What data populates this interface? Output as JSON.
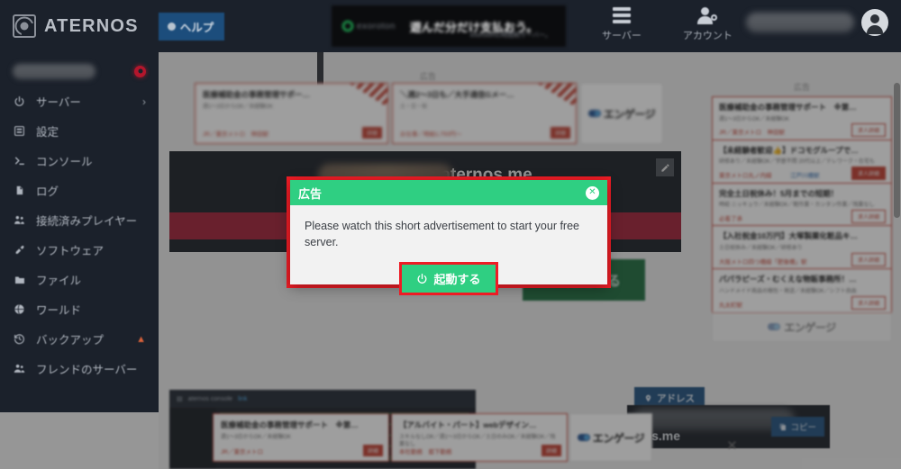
{
  "header": {
    "brand": "ATERNOS",
    "help_label": "ヘルプ",
    "ad": {
      "brand": "exoroton",
      "brand_sub": "by aternos",
      "headline": "遊んだ分だけ支払おう。",
      "subline": "exorotonの時間制サーバー。"
    },
    "nav": [
      {
        "label": "サーバー",
        "icon": "server-stack-icon"
      },
      {
        "label": "アカウント",
        "icon": "account-person-icon"
      }
    ],
    "user": {
      "name_redacted": "",
      "status_redacted": ""
    }
  },
  "sidebar": {
    "server_name_redacted": "",
    "status": "offline",
    "items": [
      {
        "label": "サーバー",
        "icon": "power-icon",
        "chevron": "›",
        "warn": ""
      },
      {
        "label": "設定",
        "icon": "sliders-icon",
        "chevron": "",
        "warn": ""
      },
      {
        "label": "コンソール",
        "icon": "terminal-icon",
        "chevron": "",
        "warn": ""
      },
      {
        "label": "ログ",
        "icon": "document-icon",
        "chevron": "",
        "warn": ""
      },
      {
        "label": "接続済みプレイヤー",
        "icon": "players-icon",
        "chevron": "",
        "warn": ""
      },
      {
        "label": "ソフトウェア",
        "icon": "plug-icon",
        "chevron": "",
        "warn": ""
      },
      {
        "label": "ファイル",
        "icon": "folder-icon",
        "chevron": "",
        "warn": ""
      },
      {
        "label": "ワールド",
        "icon": "globe-icon",
        "chevron": "",
        "warn": ""
      },
      {
        "label": "バックアップ",
        "icon": "history-icon",
        "chevron": "",
        "warn": "▲"
      },
      {
        "label": "フレンドのサーバー",
        "icon": "friends-icon",
        "chevron": "",
        "warn": ""
      }
    ]
  },
  "main": {
    "ad_label": "広告",
    "server_address_suffix": "aternos.me",
    "server_name_redacted": "",
    "edit_icon": "pencil-icon",
    "start_button_label": "起動する",
    "address_tab_label": "アドレス",
    "address_value_suffix": "nos.me",
    "copy_button_label": "コピー",
    "close_label": "×",
    "engage_brand": "エンゲージ"
  },
  "ads": {
    "top": [
      {
        "title": "医療補助金の事務管理サポー…",
        "desc": "週1〜3日からOK／未経験OK",
        "meta": "JR／東京メトロ　神田駅",
        "button": "詳細"
      },
      {
        "title": "＼週2〜3日も／大手通信Gメー…",
        "desc": "土・日・祝",
        "meta": "お仕事／時給1,750円〜",
        "button": "詳細"
      }
    ],
    "right": [
      {
        "title": "医療補助金の事務管理サポート　※第…",
        "desc": "週1〜3日からOK／未経験OK",
        "meta": "JR／東京メトロ　神田駅",
        "meta2": "",
        "pill": "求人詳細",
        "pill_filled": false
      },
      {
        "title": "【未経験者歓迎👍】ドコモグループで…",
        "desc": "研修あり／未経験OK／学歴不問 20代以上／テレワーク・在宅も",
        "meta": "東京メトロ丸ノ内線",
        "meta2": "江戸川橋駅",
        "pill": "求人詳細",
        "pill_filled": true
      },
      {
        "title": "完全土日祝休み！5月までの短期！",
        "desc": "時給 ニッキュウ／未経験OK／軽作業・カンタン作業／残業なし",
        "meta": "必着了承",
        "meta2": "",
        "pill": "求人詳細",
        "pill_filled": false
      },
      {
        "title": "【入社祝金10万円】大塚製薬化粧品キ…",
        "desc": "土日祝休み／未経験OK／研修あり",
        "meta": "大阪メトロ四つ橋線「肥後橋」駅",
        "meta2": "",
        "pill": "求人詳細",
        "pill_filled": false
      },
      {
        "title": "パパラピーズ・むくえな物販事務所！…",
        "desc": "ハンドメイド商品の梱包・発送／未経験OK／シフト自由",
        "meta": "丸太町駅",
        "meta2": "",
        "pill": "求人詳細",
        "pill_filled": false
      }
    ],
    "bottom": [
      {
        "title": "医療補助金の事務管理サポート　※第…",
        "desc": "週1〜3日からOK／未経験OK",
        "meta": "JR／東京メトロ",
        "button": "詳細"
      },
      {
        "title": "【アルバイト・パート】webデザイン…",
        "desc": "スキルなしOK／週1〜3日からOK／土日のみOK／未経験OK／残業なし",
        "meta": "本社勤務　都下勤務",
        "button": "詳細"
      }
    ]
  },
  "modal": {
    "title": "広告",
    "close_icon": "close-circle-icon",
    "body_text": "Please watch this short advertisement to start your free server.",
    "button_label": "起動する",
    "button_icon": "power-icon",
    "accent_color": "#2fcf82",
    "annotation_color": "#ee1c25"
  }
}
